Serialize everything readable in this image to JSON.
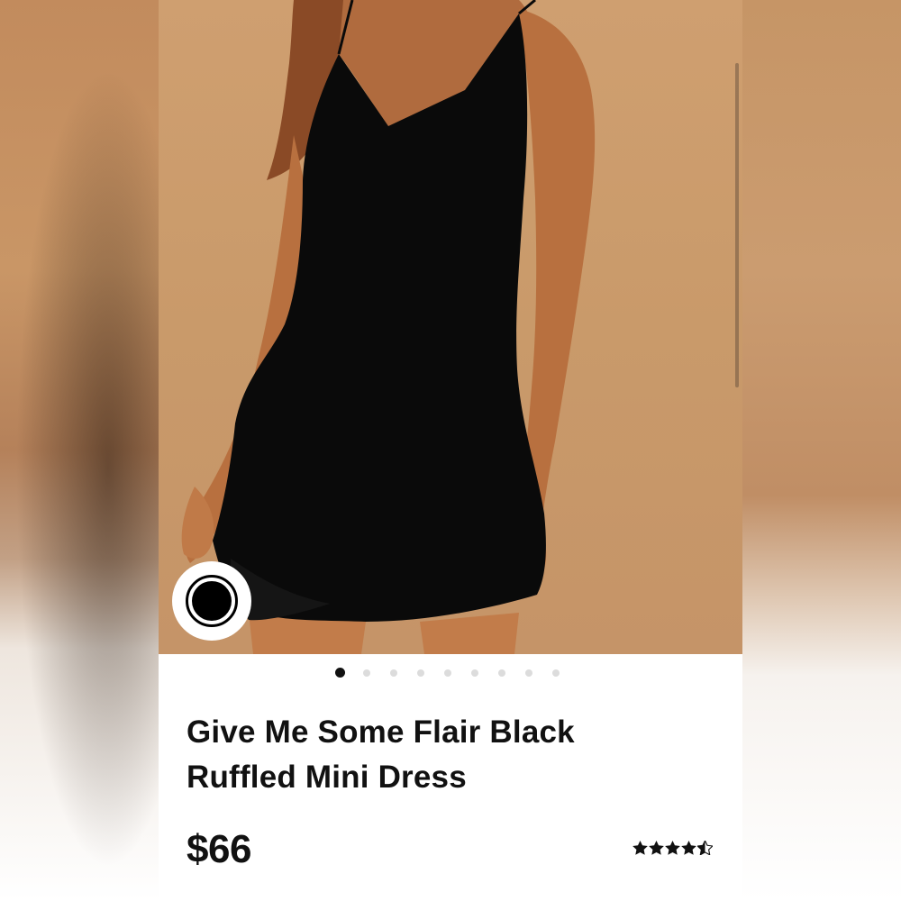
{
  "product": {
    "title_line1": "Give Me Some Flair Black",
    "title_line2": "Ruffled Mini Dress",
    "price": "$66",
    "rating": 4.5,
    "rating_max": 5
  },
  "gallery": {
    "image_count": 9,
    "active_index": 0
  },
  "color_swatch": {
    "selected_color": "#000000"
  },
  "colors": {
    "background_tan": "#c99a6a",
    "dress": "#0a0a0a",
    "text": "#111111",
    "dot_inactive": "#dcdcdc"
  }
}
